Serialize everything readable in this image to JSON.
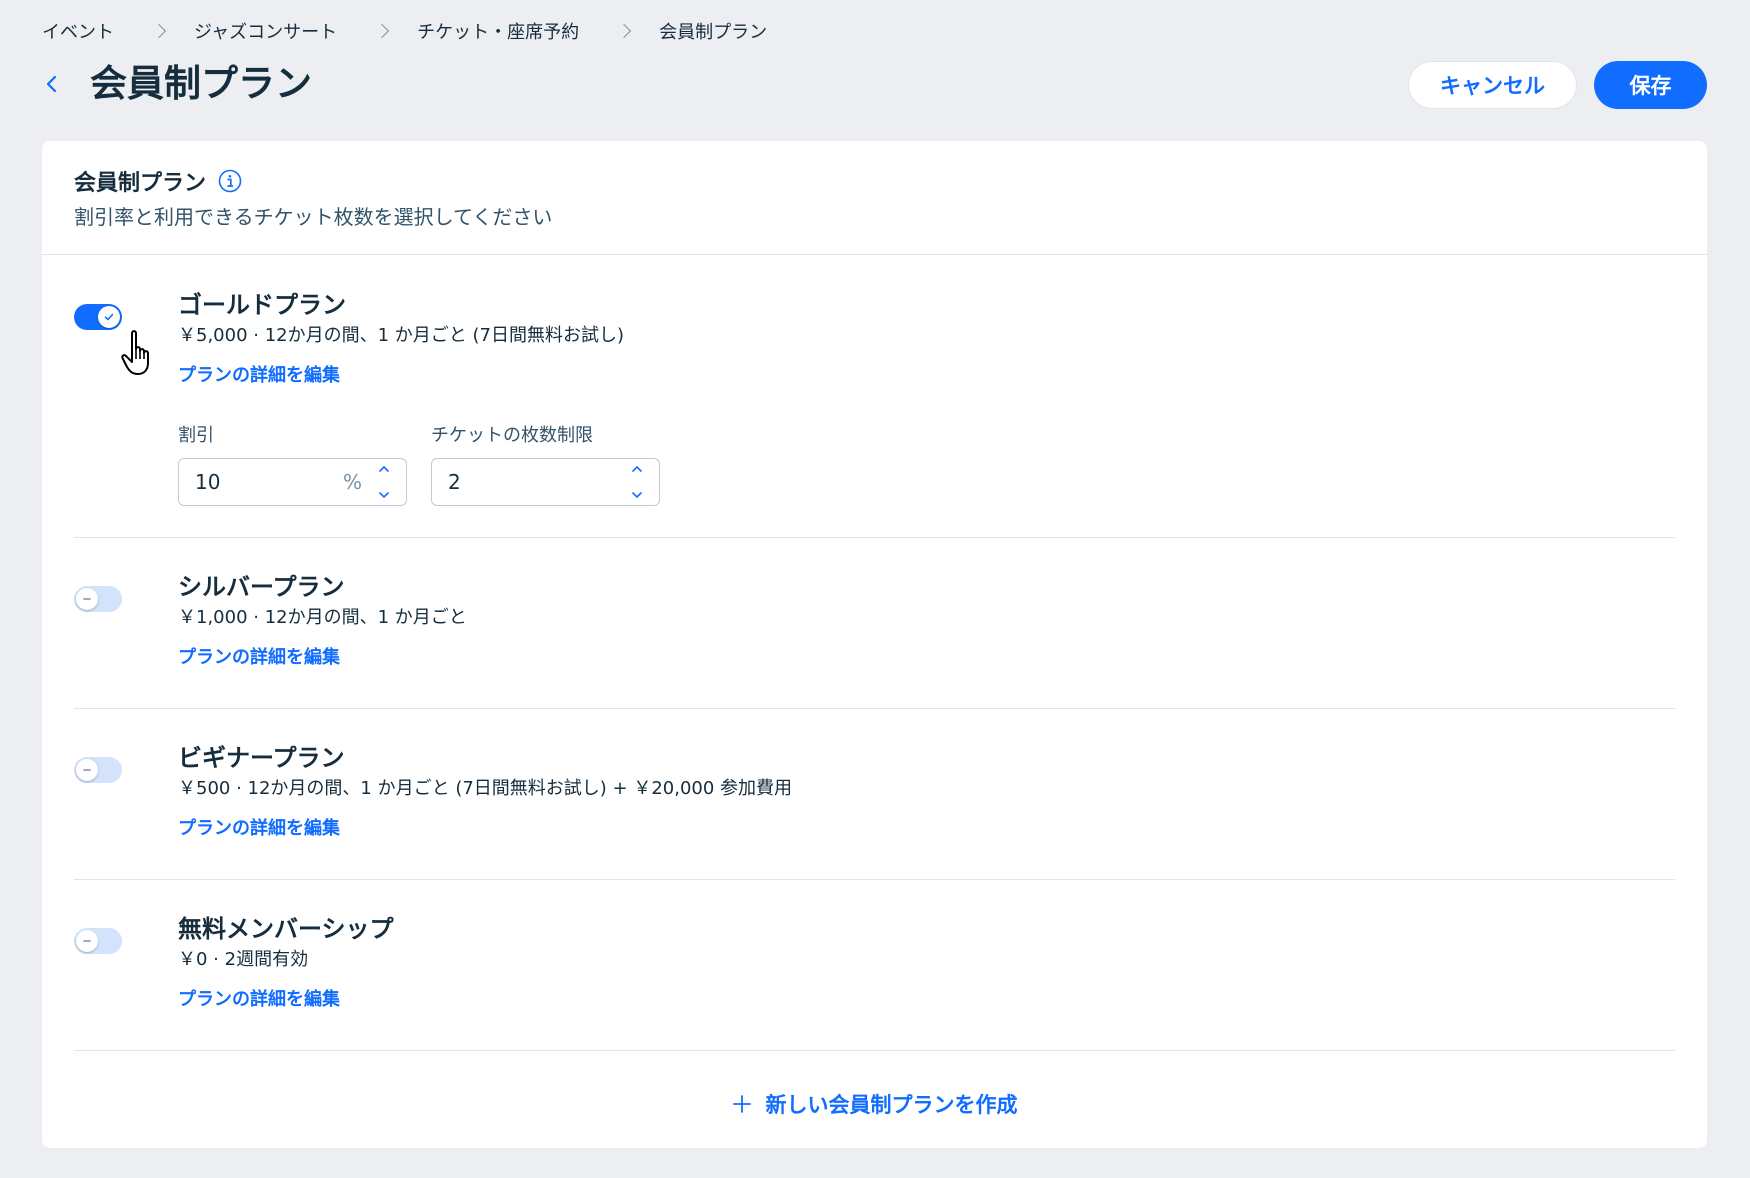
{
  "breadcrumb": [
    "イベント",
    "ジャズコンサート",
    "チケット・座席予約",
    "会員制プラン"
  ],
  "header": {
    "title": "会員制プラン",
    "cancel_label": "キャンセル",
    "save_label": "保存"
  },
  "card": {
    "title": "会員制プラン",
    "subtitle": "割引率と利用できるチケット枚数を選択してください"
  },
  "plans": [
    {
      "name": "ゴールドプラン",
      "desc": "￥5,000 · 12か月の間、1 か月ごと (7日間無料お試し)",
      "edit_label": "プランの詳細を編集",
      "enabled": true,
      "discount_label": "割引",
      "discount_value": "10",
      "discount_unit": "%",
      "limit_label": "チケットの枚数制限",
      "limit_value": "2"
    },
    {
      "name": "シルバープラン",
      "desc": "￥1,000 · 12か月の間、1 か月ごと",
      "edit_label": "プランの詳細を編集",
      "enabled": false
    },
    {
      "name": "ビギナープラン",
      "desc": "￥500 · 12か月の間、1 か月ごと (7日間無料お試し) + ￥20,000 参加費用",
      "edit_label": "プランの詳細を編集",
      "enabled": false
    },
    {
      "name": "無料メンバーシップ",
      "desc": "￥0 · 2週間有効",
      "edit_label": "プランの詳細を編集",
      "enabled": false
    }
  ],
  "create_label": "新しい会員制プランを作成",
  "colors": {
    "accent": "#116dff",
    "toggle_off": "#d3e3fb",
    "background": "#eceef2"
  }
}
